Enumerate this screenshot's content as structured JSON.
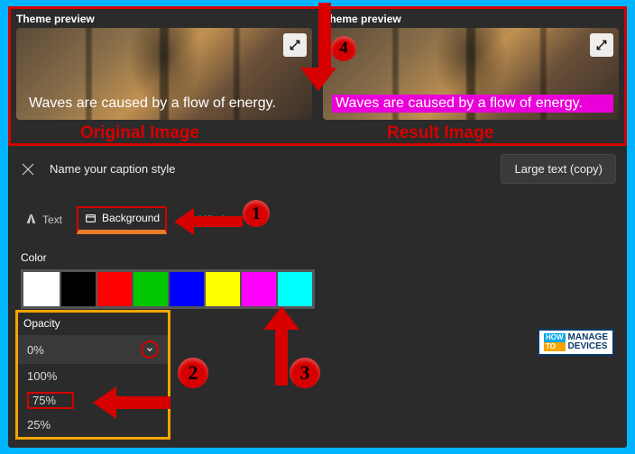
{
  "preview": {
    "title": "Theme preview",
    "caption": "Waves are caused by a flow of energy.",
    "label_original": "Original Image",
    "label_result": "Result Image"
  },
  "style": {
    "name_placeholder": "Name your caption style",
    "preset_label": "Large text (copy)"
  },
  "tabs": {
    "text": "Text",
    "background": "Background",
    "window": "Window"
  },
  "color": {
    "label": "Color",
    "swatches": [
      "#ffffff",
      "#000000",
      "#ff0000",
      "#00c800",
      "#0000ff",
      "#ffff00",
      "#ff00ff",
      "#00ffff"
    ]
  },
  "opacity": {
    "label": "Opacity",
    "selected": "0%",
    "options": [
      "100%",
      "75%",
      "25%"
    ]
  },
  "annotations": {
    "n1": "1",
    "n2": "2",
    "n3": "3",
    "n4": "4"
  },
  "watermark": {
    "how": "HOW",
    "to": "TO",
    "line1": "MANAGE",
    "line2": "DEVICES"
  }
}
